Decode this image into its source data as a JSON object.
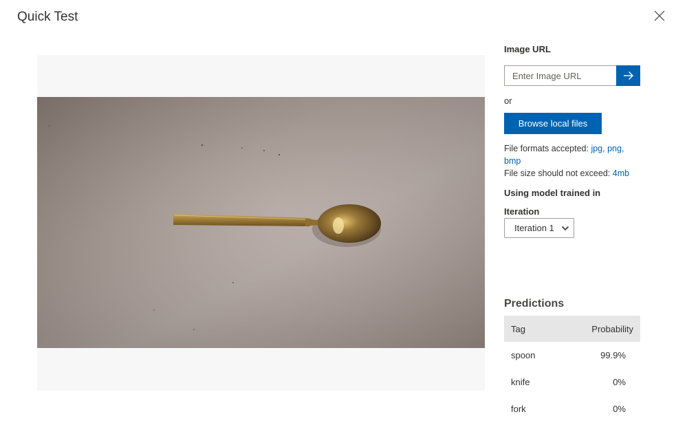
{
  "dialog": {
    "title": "Quick Test",
    "close_icon": "close-icon"
  },
  "preview": {
    "image_description_icon": "photo-preview"
  },
  "panel": {
    "image_url_label": "Image URL",
    "url_placeholder": "Enter Image URL",
    "url_value": "",
    "submit_icon": "arrow-right-icon",
    "or_text": "or",
    "browse_label": "Browse local files",
    "formats_prefix": "File formats accepted:",
    "format_jpg": "jpg,",
    "format_png": "png,",
    "format_bmp": "bmp",
    "size_prefix": "File size should not exceed:",
    "size_value": "4mb",
    "using_model_label": "Using model trained in",
    "iteration_label": "Iteration",
    "iteration_selected": "Iteration 1",
    "iteration_chevron_icon": "chevron-down-icon"
  },
  "predictions": {
    "title": "Predictions",
    "columns": [
      "Tag",
      "Probability"
    ],
    "rows": [
      {
        "tag": "spoon",
        "probability": "99.9%"
      },
      {
        "tag": "knife",
        "probability": "0%"
      },
      {
        "tag": "fork",
        "probability": "0%"
      }
    ]
  },
  "colors": {
    "accent": "#0063b1",
    "table_header_bg": "#e6e6e6",
    "preview_bg": "#f7f7f7"
  }
}
